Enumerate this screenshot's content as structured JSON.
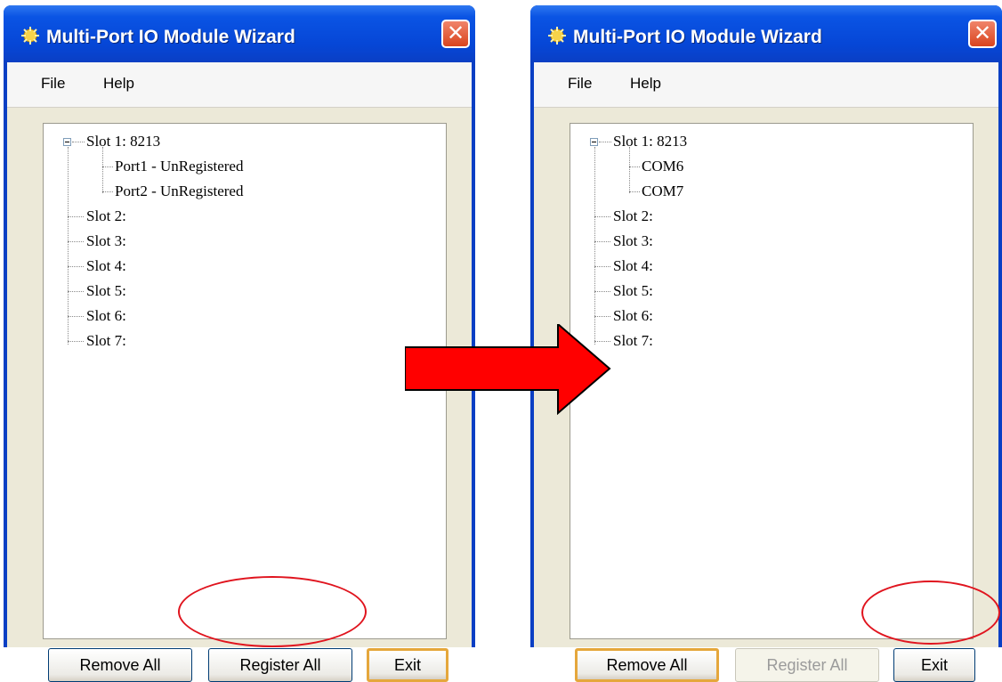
{
  "colors": {
    "titlebar": "#0a54e4",
    "client": "#ece9d8",
    "highlight": "#e0141e",
    "arrow": "#ff0000"
  },
  "left_window": {
    "title": "Multi-Port IO Module Wizard",
    "close_glyph": "✕",
    "menu": [
      "File",
      "Help"
    ],
    "tree": {
      "slot1": "Slot 1: 8213",
      "ports": [
        "Port1 - UnRegistered",
        "Port2 - UnRegistered"
      ],
      "other_slots": [
        "Slot 2:",
        "Slot 3:",
        "Slot 4:",
        "Slot 5:",
        "Slot 6:",
        "Slot 7:"
      ]
    },
    "buttons": {
      "remove_all": "Remove All",
      "register_all": "Register All",
      "exit": "Exit"
    }
  },
  "right_window": {
    "title": "Multi-Port IO Module Wizard",
    "close_glyph": "✕",
    "menu": [
      "File",
      "Help"
    ],
    "tree": {
      "slot1": "Slot 1: 8213",
      "ports": [
        "COM6",
        "COM7"
      ],
      "other_slots": [
        "Slot 2:",
        "Slot 3:",
        "Slot 4:",
        "Slot 5:",
        "Slot 6:",
        "Slot 7:"
      ]
    },
    "buttons": {
      "remove_all": "Remove All",
      "register_all": "Register All",
      "exit": "Exit"
    }
  }
}
